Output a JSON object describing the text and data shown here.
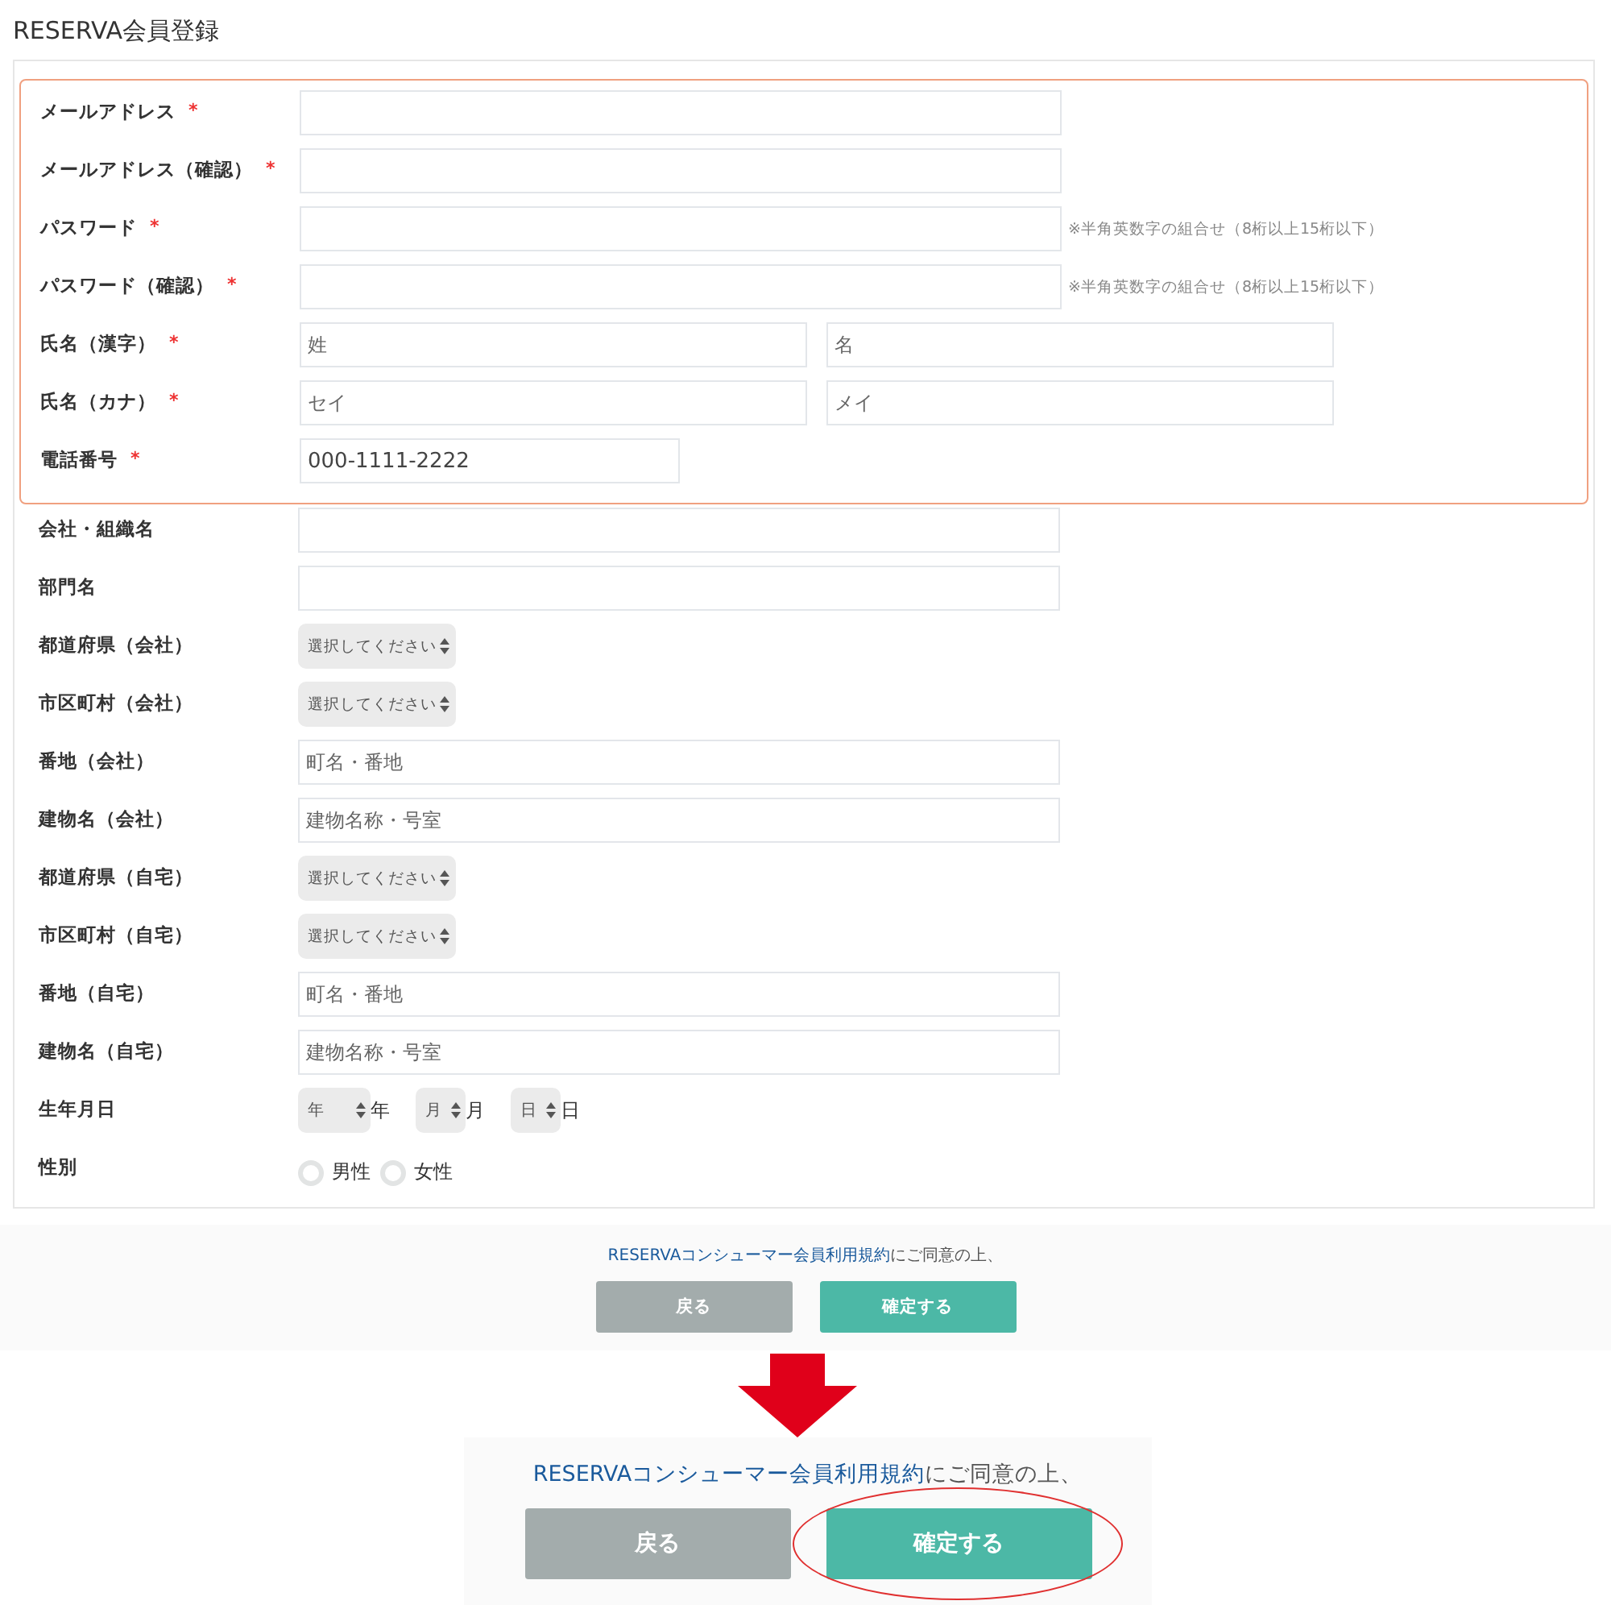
{
  "title": "RESERVA会員登録",
  "required_fields": [
    {
      "label": "メールアドレス",
      "mark": "*",
      "kind": "text"
    },
    {
      "label": "メールアドレス（確認）",
      "mark": "*",
      "kind": "text"
    },
    {
      "label": "パスワード",
      "mark": "*",
      "kind": "text",
      "hint": "※半角英数字の組合せ（8桁以上15桁以下）"
    },
    {
      "label": "パスワード（確認）",
      "mark": "*",
      "kind": "text",
      "hint": "※半角英数字の組合せ（8桁以上15桁以下）"
    },
    {
      "label": "氏名（漢字）",
      "mark": "*",
      "kind": "pair",
      "placeholders": [
        "姓",
        "名"
      ]
    },
    {
      "label": "氏名（カナ）",
      "mark": "*",
      "kind": "pair",
      "placeholders": [
        "セイ",
        "メイ"
      ]
    },
    {
      "label": "電話番号",
      "mark": "*",
      "kind": "tel",
      "value": "000-1111-2222"
    }
  ],
  "optional_fields": [
    {
      "label": "会社・組織名",
      "kind": "text"
    },
    {
      "label": "部門名",
      "kind": "text"
    },
    {
      "label": "都道府県（会社）",
      "kind": "select",
      "value": "選択してください"
    },
    {
      "label": "市区町村（会社）",
      "kind": "select",
      "value": "選択してください"
    },
    {
      "label": "番地（会社）",
      "kind": "text",
      "placeholder": "町名・番地"
    },
    {
      "label": "建物名（会社）",
      "kind": "text",
      "placeholder": "建物名称・号室"
    },
    {
      "label": "都道府県（自宅）",
      "kind": "select",
      "value": "選択してください"
    },
    {
      "label": "市区町村（自宅）",
      "kind": "select",
      "value": "選択してください"
    },
    {
      "label": "番地（自宅）",
      "kind": "text",
      "placeholder": "町名・番地"
    },
    {
      "label": "建物名（自宅）",
      "kind": "text",
      "placeholder": "建物名称・号室"
    },
    {
      "label": "生年月日",
      "kind": "date",
      "parts": [
        {
          "value": "年",
          "suffix": "年"
        },
        {
          "value": "月",
          "suffix": "月"
        },
        {
          "value": "日",
          "suffix": "日"
        }
      ]
    },
    {
      "label": "性別",
      "kind": "radio",
      "options": [
        {
          "label": "男性",
          "selected": false
        },
        {
          "label": "女性",
          "selected": false
        }
      ]
    }
  ],
  "footer": {
    "terms_link": "RESERVAコンシューマー会員利用規約",
    "terms_suffix": "にご同意の上、",
    "buttons": [
      {
        "label": "戻る",
        "kind": "back",
        "highlighted": false
      },
      {
        "label": "確定する",
        "kind": "confirm",
        "highlighted": false
      }
    ]
  },
  "zoomed_footer": {
    "terms_link": "RESERVAコンシューマー会員利用規約",
    "terms_suffix": "にご同意の上、",
    "buttons": [
      {
        "label": "戻る",
        "kind": "back",
        "highlighted": false
      },
      {
        "label": "確定する",
        "kind": "confirm",
        "highlighted": true
      }
    ]
  }
}
